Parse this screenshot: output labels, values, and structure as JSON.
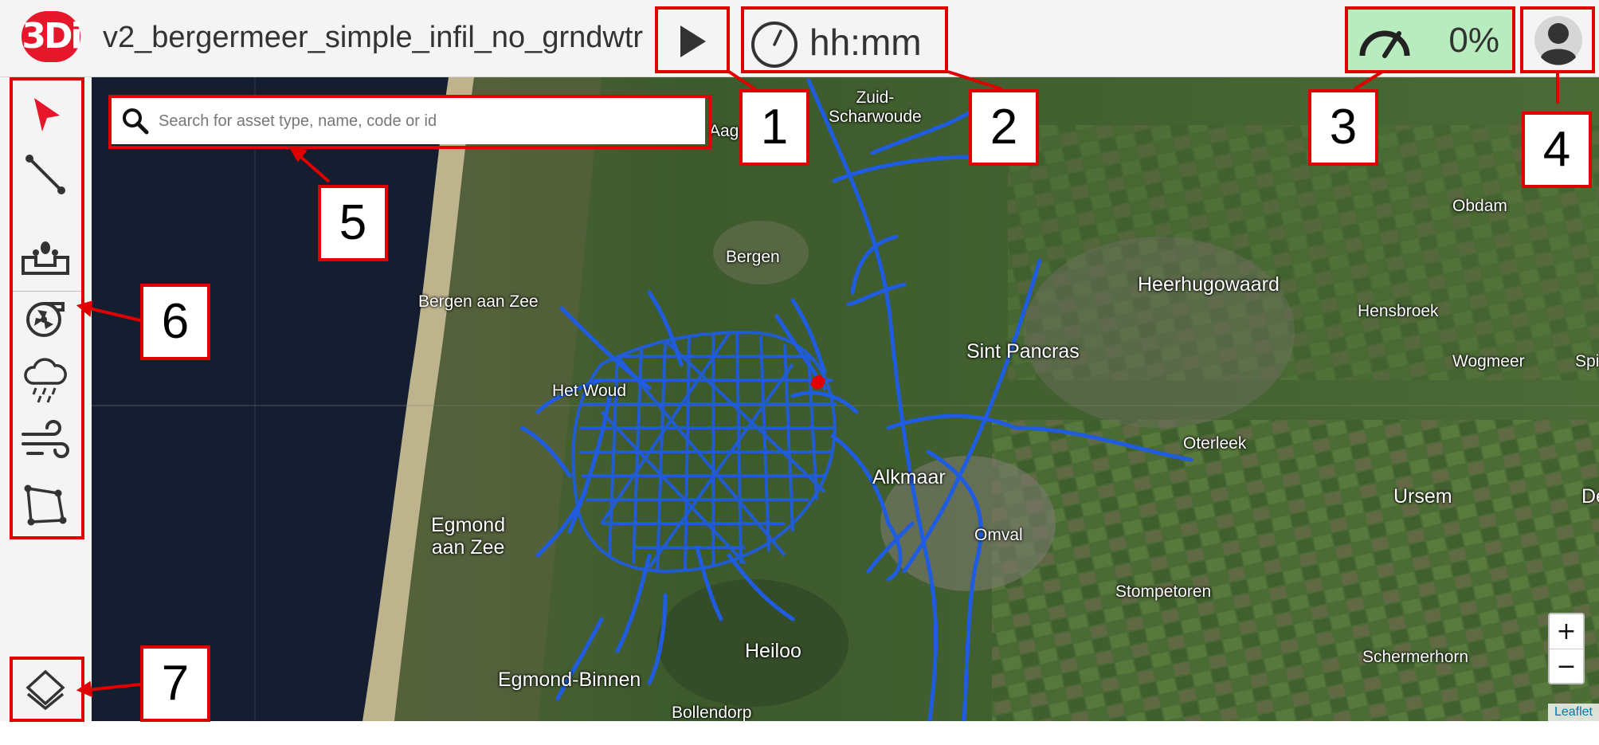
{
  "app": {
    "logo_text": "3Di",
    "model_name": "v2_bergermeer_simple_infil_no_grndwtr"
  },
  "toolbar": {
    "play_icon": "play-icon",
    "time_display": "hh:mm",
    "progress_label": "0%",
    "progress_color": "#b8ecbf",
    "user_icon": "user-avatar-icon"
  },
  "sidebar": {
    "tools": [
      {
        "name": "select",
        "icon": "cursor-arrow-icon",
        "color": "#e6162b"
      },
      {
        "name": "draw-line",
        "icon": "line-icon"
      },
      {
        "name": "discharge",
        "icon": "discharge-icon"
      },
      {
        "name": "pump",
        "icon": "pump-icon"
      },
      {
        "name": "rain",
        "icon": "rain-cloud-icon"
      },
      {
        "name": "wind",
        "icon": "wind-icon"
      },
      {
        "name": "polygon",
        "icon": "polygon-icon"
      }
    ],
    "layers_icon": "layers-icon"
  },
  "search": {
    "placeholder": "Search for asset type, name, code or id",
    "value": ""
  },
  "map": {
    "labels": {
      "zuid_scharwoude": "Zuid-\nScharwoude",
      "obdam": "Obdam",
      "bergen": "Bergen",
      "heerhugowaard": "Heerhugowaard",
      "bergen_aan_zee": "Bergen aan Zee",
      "hensbroek": "Hensbroek",
      "sint_pancras": "Sint Pancras",
      "wogmeer": "Wogmeer",
      "het_woud": "Het Woud",
      "oterleek": "Oterleek",
      "alkmaar": "Alkmaar",
      "ursem": "Ursem",
      "egmond_aan_zee": "Egmond\naan Zee",
      "omval": "Omval",
      "stompetoren": "Stompetoren",
      "heiloo": "Heiloo",
      "schermerhorn": "Schermerhorn",
      "egmond_binnen": "Egmond-Binnen",
      "bollendorp": "Bollendorp",
      "aag": "Aag",
      "spi": "Spi",
      "de": "De"
    },
    "network_color": "#1f5ce0",
    "zoom_in": "+",
    "zoom_out": "−",
    "attribution": "Leaflet"
  },
  "callouts": [
    "1",
    "2",
    "3",
    "4",
    "5",
    "6",
    "7"
  ],
  "colors": {
    "highlight": "#e00000",
    "brand": "#e6162b"
  }
}
